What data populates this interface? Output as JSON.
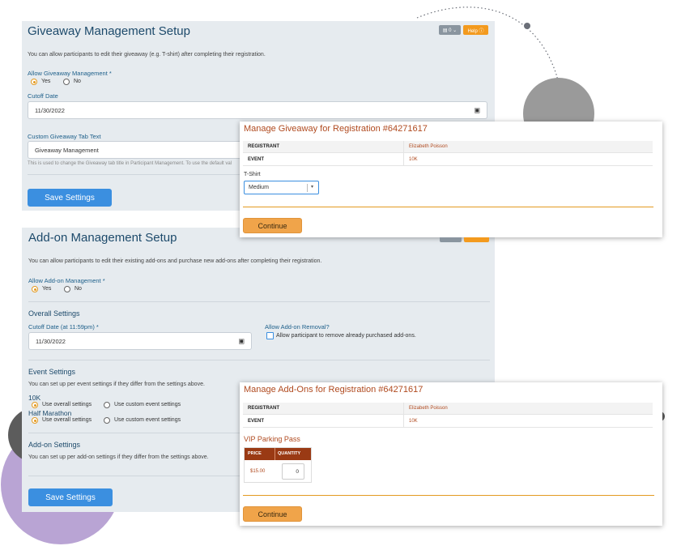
{
  "giveaway_panel": {
    "title": "Giveaway Management Setup",
    "toolbox_label": "▤ 0 ⌄",
    "help_label": "Help ⓘ",
    "description": "You can allow participants to edit their giveaway (e.g. T-shirt) after completing their registration.",
    "allow_label": "Allow Giveaway Management *",
    "yes_label": "Yes",
    "no_label": "No",
    "cutoff_label": "Cutoff Date",
    "cutoff_value": "11/30/2022",
    "tab_text_label": "Custom Giveaway Tab Text",
    "tab_text_value": "Giveaway Management",
    "tab_text_hint": "This is used to change the Giveaway tab title in Participant Management. To use the default val",
    "save_label": "Save Settings"
  },
  "addon_panel": {
    "title": "Add-on Management Setup",
    "description": "You can allow participants to edit their existing add-ons and purchase new add-ons after completing their registration.",
    "allow_label": "Allow Add-on Management *",
    "yes_label": "Yes",
    "no_label": "No",
    "overall_heading": "Overall Settings",
    "cutoff_label": "Cutoff Date (at 11:59pm) *",
    "cutoff_value": "11/30/2022",
    "removal_label": "Allow Add-on Removal?",
    "removal_checkbox_label": "Allow participant to remove already purchased add-ons.",
    "event_heading": "Event Settings",
    "event_description": "You can set up per event settings if they differ from the settings above.",
    "events": [
      {
        "name": "10K",
        "opt_overall": "Use overall settings",
        "opt_custom": "Use custom event settings"
      },
      {
        "name": "Half Marathon",
        "opt_overall": "Use overall settings",
        "opt_custom": "Use custom event settings"
      }
    ],
    "addon_heading": "Add-on Settings",
    "addon_description": "You can set up per add-on settings if they differ from the settings above.",
    "save_label": "Save Settings"
  },
  "giveaway_modal": {
    "title": "Manage Giveaway for Registration #64271617",
    "registrant_key": "REGISTRANT",
    "registrant_value": "Elizabeth Poisson",
    "event_key": "EVENT",
    "event_value": "10K",
    "tshirt_label": "T-Shirt",
    "tshirt_value": "Medium",
    "continue_label": "Continue"
  },
  "addons_modal": {
    "title": "Manage Add-Ons for Registration #64271617",
    "registrant_key": "REGISTRANT",
    "registrant_value": "Elizabeth Poisson",
    "event_key": "EVENT",
    "event_value": "10K",
    "item_name": "VIP Parking Pass",
    "price_header": "PRICE",
    "quantity_header": "QUANTITY",
    "price_value": "$15.00",
    "quantity_value": "0",
    "continue_label": "Continue"
  },
  "colors": {
    "panel_bg": "#e6ebef",
    "primary_blue": "#3b8fe0",
    "accent_orange": "#f0a44a",
    "modal_title": "#b04a1f"
  }
}
